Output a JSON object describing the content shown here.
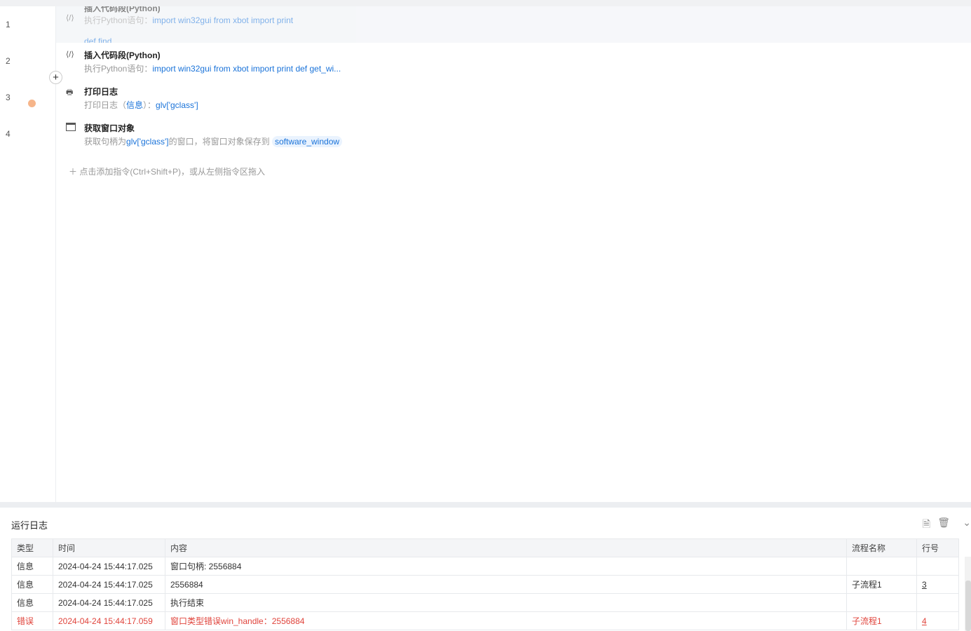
{
  "steps": [
    {
      "num": "1",
      "title": "插入代码段(Python)",
      "desc_prefix": "执行Python语句：",
      "desc_value": "import win32gui from xbot import print",
      "extra": "def find ...",
      "icon": "code-icon"
    },
    {
      "num": "2",
      "title": "插入代码段(Python)",
      "desc_prefix": "执行Python语句：",
      "desc_value": "import win32gui from xbot import print  def get_wi...",
      "icon": "code-icon"
    },
    {
      "num": "3",
      "title": "打印日志",
      "desc_prefix": "打印日志（",
      "desc_level": "信息",
      "desc_mid": "）：",
      "desc_value": "glv['gclass']",
      "icon": "printer-icon"
    },
    {
      "num": "4",
      "title": "获取窗口对象",
      "desc_prefix": "获取句柄为",
      "desc_value": "glv['gclass']",
      "desc_mid": "的窗口，将窗口对象保存到",
      "desc_var": "software_window",
      "icon": "window-icon"
    }
  ],
  "add_hint": "点击添加指令(Ctrl+Shift+P)，或从左侧指令区拖入",
  "log": {
    "title": "运行日志",
    "columns": [
      "类型",
      "时间",
      "内容",
      "流程名称",
      "行号"
    ],
    "rows": [
      {
        "type": "信息",
        "time": "2024-04-24 15:44:17.025",
        "content": "窗口句柄: 2556884",
        "flow": "",
        "line": ""
      },
      {
        "type": "信息",
        "time": "2024-04-24 15:44:17.025",
        "content": "2556884",
        "flow": "子流程1",
        "line": "3"
      },
      {
        "type": "信息",
        "time": "2024-04-24 15:44:17.025",
        "content": "执行结束",
        "flow": "",
        "line": ""
      },
      {
        "type": "错误",
        "time": "2024-04-24 15:44:17.059",
        "content": " 窗口类型错误win_handle：2556884",
        "flow": "子流程1",
        "line": "4"
      }
    ]
  },
  "colors": {
    "accent": "#1a73d9",
    "error": "#e0443c",
    "breakpoint": "#f6b58a"
  }
}
